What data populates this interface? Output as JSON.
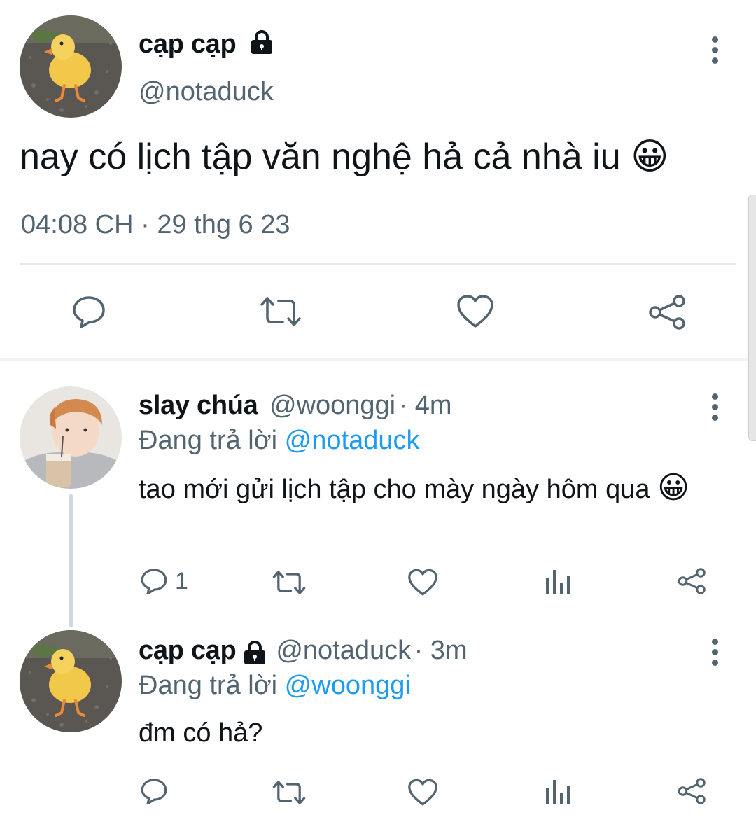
{
  "main_tweet": {
    "display_name": "cạp cạp",
    "handle": "@notaduck",
    "text": "nay có lịch tập văn nghệ hả cả nhà iu",
    "emoji": "😀",
    "time": "04:08 CH",
    "separator": "·",
    "date": "29 thg 6 23"
  },
  "replies": [
    {
      "display_name": "slay chúa",
      "handle": "@woonggi",
      "age": "· 4m",
      "replying_prefix": "Đang trả lời",
      "replying_to": "@notaduck",
      "text": "tao mới gửi lịch tập cho mày ngày hôm qua",
      "emoji": "😀",
      "reply_count": "1"
    },
    {
      "display_name": "cạp cạp",
      "handle": "@notaduck",
      "age": "· 3m",
      "replying_prefix": "Đang trả lời",
      "replying_to": "@woonggi",
      "text": "đm có hả?",
      "reply_count": ""
    }
  ],
  "colors": {
    "text": "#0f1419",
    "secondary": "#536471",
    "link": "#1d9bf0"
  }
}
